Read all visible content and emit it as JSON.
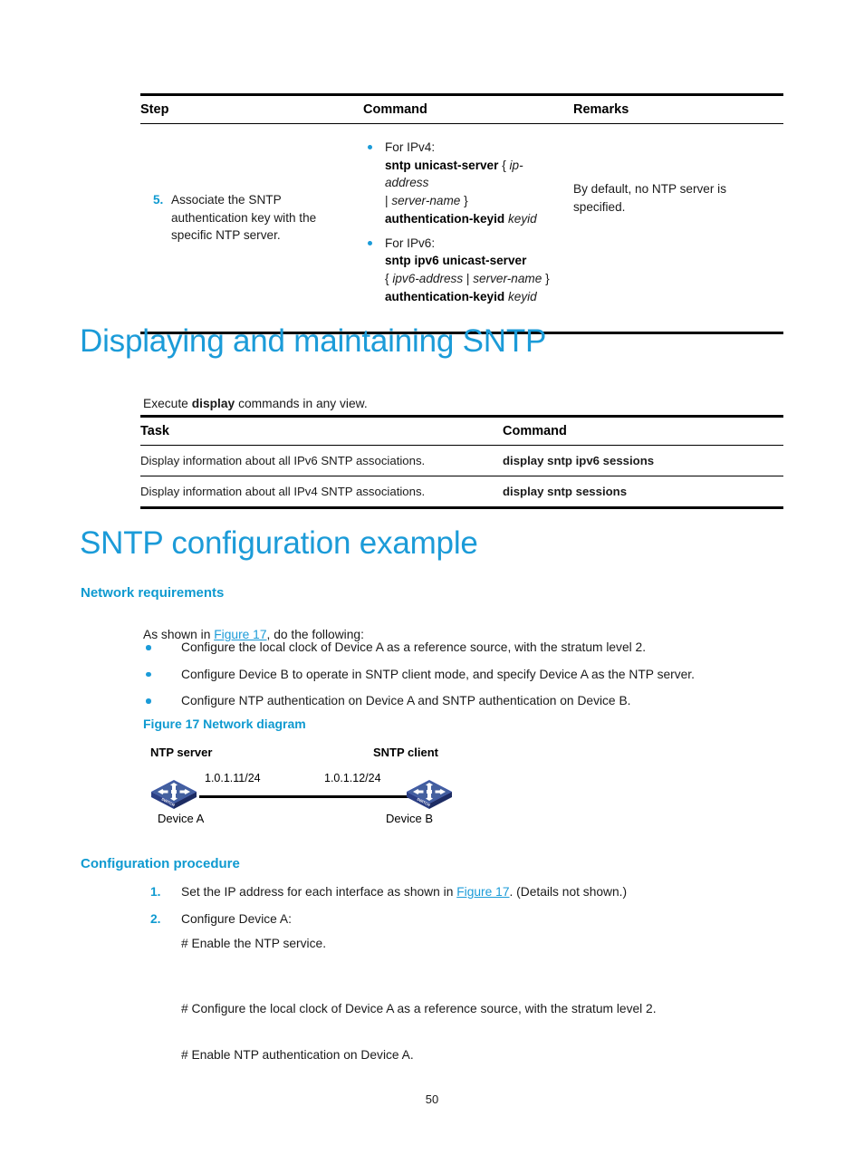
{
  "page": {
    "number": "50"
  },
  "step_table": {
    "headers": [
      "Step",
      "Command",
      "Remarks"
    ],
    "rows": [
      {
        "number": "5.",
        "step": "Associate the SNTP authentication key with the specific NTP server.",
        "command_items": [
          {
            "intro": "For IPv4:",
            "lines": [
              {
                "bold": "sntp unicast-server",
                "plain_open": " { ",
                "italic": "ip-address"
              },
              {
                "plain_pipe": "| ",
                "italic2": "server-name",
                "plain_close": " }"
              },
              {
                "bold2": "authentication-keyid",
                "italic3": " keyid"
              }
            ]
          },
          {
            "intro": "For IPv6:",
            "lines": [
              {
                "bold": "sntp ipv6 unicast-server"
              },
              {
                "plain_open": "{ ",
                "italic": "ipv6-address",
                "plain_pipe": " | ",
                "italic2": "server-name",
                "plain_close": " }"
              },
              {
                "bold2": "authentication-keyid",
                "italic3": " keyid"
              }
            ]
          }
        ],
        "remarks": "By default, no NTP server is specified."
      }
    ]
  },
  "section_display": {
    "heading": "Displaying and maintaining SNTP",
    "intro_prefix": "Execute ",
    "intro_bold": "display",
    "intro_suffix": " commands in any view.",
    "table": {
      "headers": [
        "Task",
        "Command"
      ],
      "rows": [
        {
          "task": "Display information about all IPv6 SNTP associations.",
          "command": "display sntp ipv6 sessions"
        },
        {
          "task": "Display information about all IPv4 SNTP associations.",
          "command": "display sntp sessions"
        }
      ]
    }
  },
  "section_example": {
    "heading": "SNTP configuration example",
    "network_requirements": {
      "heading": "Network requirements",
      "intro_prefix": "As shown in ",
      "intro_xref": "Figure 17",
      "intro_suffix": ", do the following:",
      "bullets": [
        "Configure the local clock of Device A as a reference source, with the stratum level 2.",
        "Configure Device B to operate in SNTP client mode, and specify Device A as the NTP server.",
        "Configure NTP authentication on Device A and SNTP authentication on Device B."
      ]
    },
    "figure": {
      "caption": "Figure 17 Network diagram",
      "left_role": "NTP server",
      "right_role": "SNTP client",
      "left_device": "Device A",
      "right_device": "Device B",
      "left_ip": "1.0.1.11/24",
      "right_ip": "1.0.1.12/24"
    },
    "configuration_procedure": {
      "heading": "Configuration procedure",
      "steps": [
        {
          "number": "1.",
          "text_prefix": "Set the IP address for each interface as shown in ",
          "xref": "Figure 17",
          "text_suffix": ". (Details not shown.)"
        },
        {
          "number": "2.",
          "text_prefix": "Configure Device A:",
          "xref": "",
          "text_suffix": ""
        }
      ],
      "comments": [
        "# Enable the NTP service.",
        "# Configure the local clock of Device A as a reference source, with the stratum level 2.",
        "# Enable NTP authentication on Device A."
      ]
    }
  },
  "colors": {
    "heading_blue": "#1b9bd8",
    "subheading_blue": "#0f9ad0",
    "bullet_blue": "#1b9bd8",
    "switch_body": "#2b3f84",
    "switch_top": "#3a54a8",
    "text": "#1a1a1a"
  }
}
